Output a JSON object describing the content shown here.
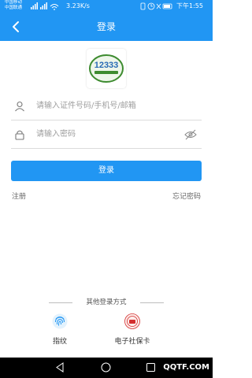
{
  "status_bar": {
    "carrier_1": "中国移动",
    "carrier_2": "中国联通",
    "speed": "3.23K/s",
    "time": "下午1:55"
  },
  "header": {
    "title": "登录"
  },
  "form": {
    "account_placeholder": "请输入证件号码/手机号/邮箱",
    "password_placeholder": "请输入密码",
    "login_label": "登录",
    "register_label": "注册",
    "forgot_label": "忘记密码"
  },
  "other_login": {
    "title": "其他登录方式",
    "options": [
      {
        "label": "指纹",
        "icon": "fingerprint-icon"
      },
      {
        "label": "电子社保卡",
        "icon": "social-security-card-icon"
      }
    ]
  },
  "logo": {
    "text": "12333"
  },
  "watermark": "QQTF.COM",
  "colors": {
    "primary": "#2196f3",
    "text_muted": "#9e9e9e",
    "fingerprint": "#2196f3",
    "card_red": "#d32f2f"
  }
}
